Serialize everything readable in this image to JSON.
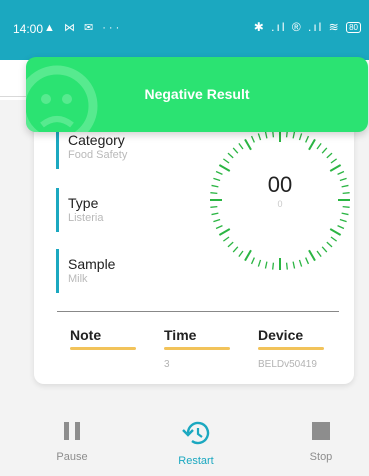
{
  "status_bar": {
    "time": "14:00",
    "left_icons": "▲ ⋈ ✉ ···",
    "right_icons": "✱ .ıl ® .ıl ≋",
    "battery": "80"
  },
  "banner": {
    "text": "Negative Result",
    "color": "#2be372"
  },
  "fields": [
    {
      "label": "Category",
      "value": "Food Safety"
    },
    {
      "label": "Type",
      "value": "Listeria"
    },
    {
      "label": "Sample",
      "value": "Milk"
    }
  ],
  "timer": {
    "display": "00",
    "sub": "0",
    "color": "#2bb543"
  },
  "details": {
    "headers": [
      "Note",
      "Time",
      "Device"
    ],
    "values": [
      "",
      "3",
      "BELDv50419"
    ]
  },
  "nav": {
    "pause_label": "Pause",
    "restart_label": "Restart",
    "stop_label": "Stop"
  },
  "colors": {
    "accent": "#1ba8c0",
    "underline": "#f2c35a",
    "inactive": "#8d8d8d"
  }
}
